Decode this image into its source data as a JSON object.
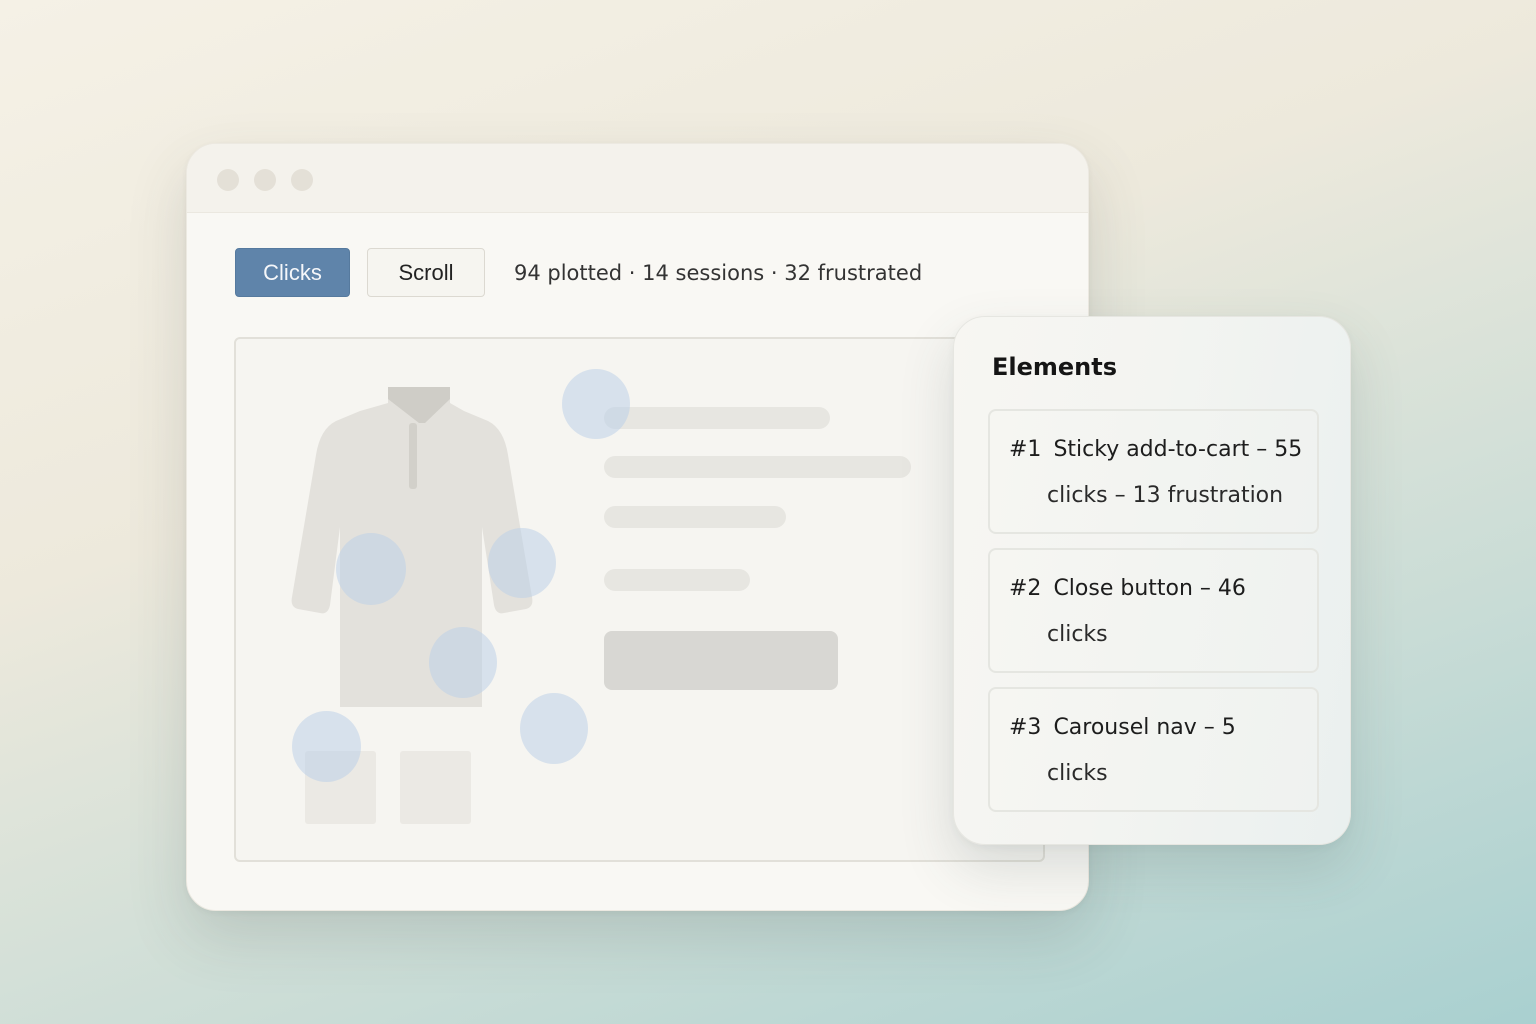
{
  "toolbar": {
    "modes": [
      "Clicks",
      "Scroll"
    ],
    "active_mode": "Clicks",
    "summary": "94 plotted · 14 sessions · 32 frustrated"
  },
  "panel": {
    "title": "Elements",
    "items": [
      {
        "rank": "#1",
        "line1": "Sticky add-to-cart – 55",
        "line2": "clicks – 13 frustration"
      },
      {
        "rank": "#2",
        "line1": "Close button – 46",
        "line2": "clicks"
      },
      {
        "rank": "#3",
        "line1": "Carousel nav – 5",
        "line2": "clicks"
      }
    ]
  },
  "colors": {
    "accent": "#5f84aa",
    "heat_spot": "#bad0e8"
  },
  "icons": {
    "preview_product": "shirt-icon"
  }
}
